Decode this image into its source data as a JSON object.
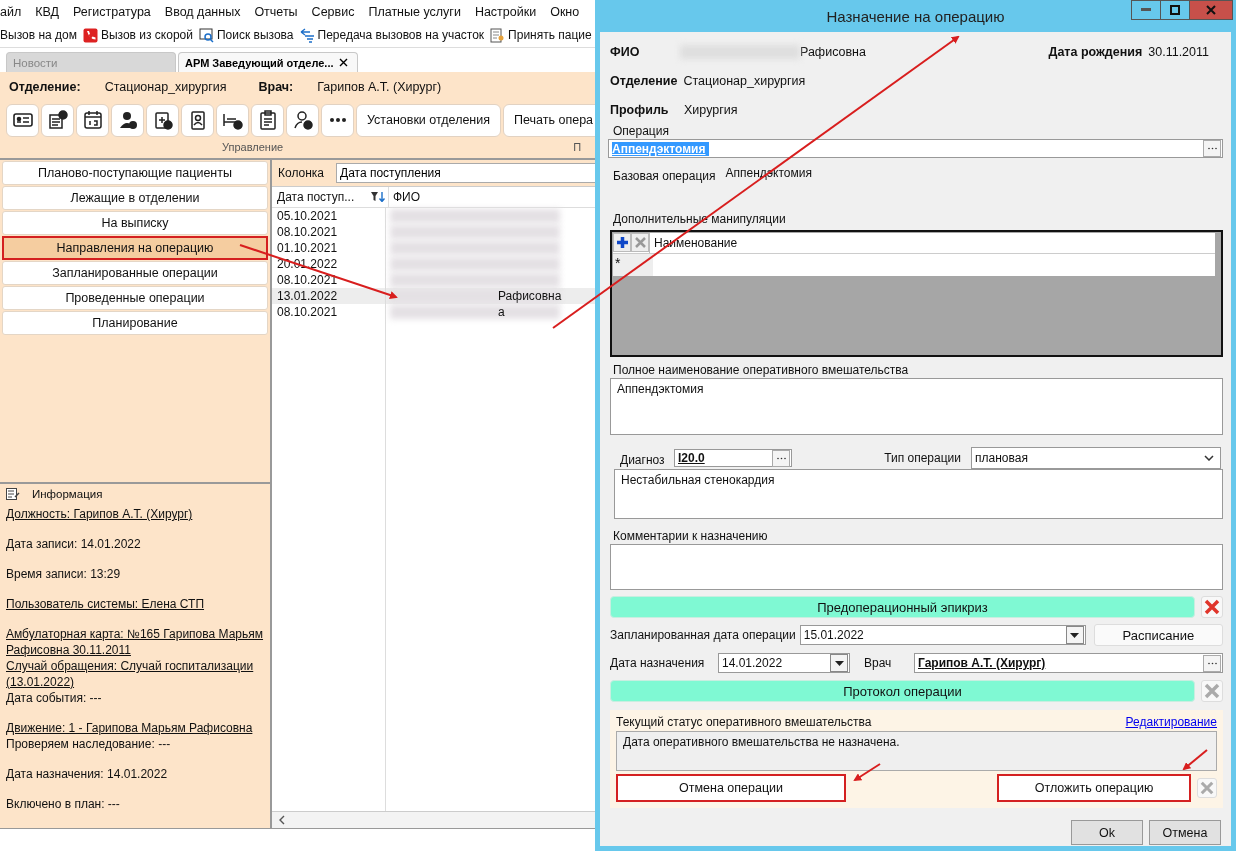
{
  "menu_bar": [
    "айл",
    "КВД",
    "Регистратура",
    "Ввод данных",
    "Отчеты",
    "Сервис",
    "Платные услуги",
    "Настройки",
    "Окно"
  ],
  "quick_toolbar": [
    "Вызов на дом",
    "Вызов из скорой",
    "Поиск вызова",
    "Передача вызовов на участок",
    "Принять пацие"
  ],
  "tabs": [
    {
      "label": "Новости",
      "selected": false,
      "closable": false
    },
    {
      "label": "АРМ Заведующий отделе...",
      "selected": true,
      "closable": true
    }
  ],
  "header": {
    "department_label": "Отделение:",
    "department": "Стационар_хирургия",
    "doctor_label": "Врач:",
    "doctor": "Гарипов А.Т. (Хирург)"
  },
  "ribbon": {
    "buttons": [
      "Установки отделения",
      "Печать опера"
    ],
    "group_label": "Управление",
    "next_group_label": "П"
  },
  "sidebar": {
    "items": [
      {
        "label": "Планово-поступающие пациенты",
        "selected": false,
        "highlighted": false
      },
      {
        "label": "Лежащие в отделении",
        "selected": false,
        "highlighted": false
      },
      {
        "label": "На выписку",
        "selected": false,
        "highlighted": false
      },
      {
        "label": "Направления на операцию",
        "selected": true,
        "highlighted": true
      },
      {
        "label": "Запланированные операции",
        "selected": false,
        "highlighted": false
      },
      {
        "label": "Проведенные операции",
        "selected": false,
        "highlighted": false
      },
      {
        "label": "Планирование",
        "selected": false,
        "highlighted": false
      }
    ]
  },
  "info": {
    "title": "Информация",
    "blocks": [
      [
        {
          "text": "Должность: Гарипов А.Т. (Хирург)",
          "link": true
        }
      ],
      [
        {
          "text": "Дата записи: 14.01.2022",
          "link": false
        }
      ],
      [
        {
          "text": "Время записи: 13:29",
          "link": false
        }
      ],
      [
        {
          "text": "Пользователь системы: Елена  СТП",
          "link": true
        }
      ],
      [
        {
          "text": "Амбулаторная карта: №165 Гарипова Марьям Рафисовна 30.11.2011",
          "link": true
        },
        {
          "text": "Случай обращения: Случай госпитализации (13.01.2022)",
          "link": true
        },
        {
          "text": "Дата события: ---",
          "link": false
        }
      ],
      [
        {
          "text": "Движение: 1 - Гарипова Марьям Рафисовна",
          "link": true
        },
        {
          "text": "Проверяем наследование: ---",
          "link": false
        }
      ],
      [
        {
          "text": "Дата назначения: 14.01.2022",
          "link": false
        }
      ],
      [
        {
          "text": "Включено в план: ---",
          "link": false
        }
      ]
    ]
  },
  "filter": {
    "label": "Колонка",
    "value": "Дата поступления"
  },
  "table": {
    "columns": [
      "Дата поступ...",
      "ФИО"
    ],
    "rows": [
      {
        "date": "05.10.2021",
        "redacted": true,
        "selected": false
      },
      {
        "date": "08.10.2021",
        "redacted": true,
        "selected": false
      },
      {
        "date": "01.10.2021",
        "redacted": true,
        "selected": false
      },
      {
        "date": "20.01.2022",
        "redacted": true,
        "selected": false
      },
      {
        "date": "08.10.2021",
        "redacted": true,
        "selected": false
      },
      {
        "date": "13.01.2022",
        "redacted": true,
        "fio": "Рафисовна",
        "selected": true
      },
      {
        "date": "08.10.2021",
        "redacted": true,
        "fio": "а",
        "selected": false
      }
    ]
  },
  "dialog": {
    "title": "Назначение на операцию",
    "fio_label": "ФИО",
    "fio": "Рафисовна",
    "birth_label": "Дата рождения",
    "birth": "30.11.2011",
    "department_label": "Отделение",
    "department": "Стационар_хирургия",
    "profile_label": "Профиль",
    "profile": "Хирургия",
    "operation_label": "Операция",
    "operation": "Аппендэктомия",
    "base_label": "Базовая операция",
    "base": "Аппендэктомия",
    "extra_label": "Дополнительные манипуляции",
    "extra_column": "Наименование",
    "new_row_mark": "*",
    "full_name_label": "Полное наименование оперативного вмешательства",
    "full_name": "Аппендэктомия",
    "diagnosis_label": "Диагноз",
    "diagnosis_code": "I20.0",
    "op_type_label": "Тип операции",
    "op_type": "плановая",
    "diagnosis_text": "Нестабильная стенокардия",
    "comments_label": "Комментарии к назначению",
    "epicrisis": {
      "label": "Предоперационный эпикриз",
      "delete_enabled": true
    },
    "planned_date_label": "Запланированная дата операции",
    "planned_date": "15.01.2022",
    "schedule_button": "Расписание",
    "assign_date_label": "Дата назначения",
    "assign_date": "14.01.2022",
    "doctor_label": "Врач",
    "doctor": "Гарипов А.Т. (Хирург)",
    "protocol": {
      "label": "Протокол операции",
      "delete_enabled": false
    },
    "status_label": "Текущий статус оперативного вмешательства",
    "edit_link": "Редактирование",
    "status_text": "Дата оперативного вмешательства не назначена.",
    "cancel_operation": {
      "label": "Отмена операции",
      "highlighted": true
    },
    "postpone_operation": {
      "label": "Отложить операцию",
      "highlighted": true,
      "delete_enabled": false
    },
    "ok": "Ok",
    "cancel": "Отмена"
  }
}
